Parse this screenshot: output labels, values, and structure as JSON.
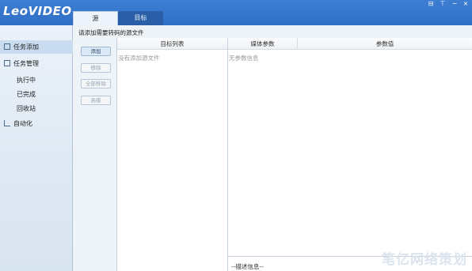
{
  "app": {
    "logo": "LeoVIDEO",
    "window_controls": [
      "⊟",
      "⊤",
      "−",
      "×"
    ]
  },
  "tabs": [
    {
      "label": "源",
      "active": true
    },
    {
      "label": "目标",
      "active": false
    }
  ],
  "sidebar": {
    "items": [
      {
        "label": "任务添加",
        "selected": true
      },
      {
        "label": "任务管理",
        "selected": false
      },
      {
        "label": "执行中"
      },
      {
        "label": "已完成"
      },
      {
        "label": "回收站"
      },
      {
        "label": "自动化",
        "selected": false
      }
    ]
  },
  "main": {
    "hint": "请添加需要转码的源文件",
    "buttons": {
      "add": "添加",
      "remove": "移除",
      "remove_all": "全部移除",
      "advanced": "高级"
    },
    "target_list": {
      "header": "目标列表",
      "empty": "没有添加源文件"
    },
    "media_params": {
      "header_name": "媒体参数",
      "header_value": "参数值",
      "empty": "无参数信息"
    },
    "description": "--描述信息--"
  },
  "watermark": "笔亿网络策划",
  "colors": {
    "titlebar": "#3d7ed2",
    "sidebar_bg": "#eaf1f9",
    "selected": "#c9dcef"
  }
}
